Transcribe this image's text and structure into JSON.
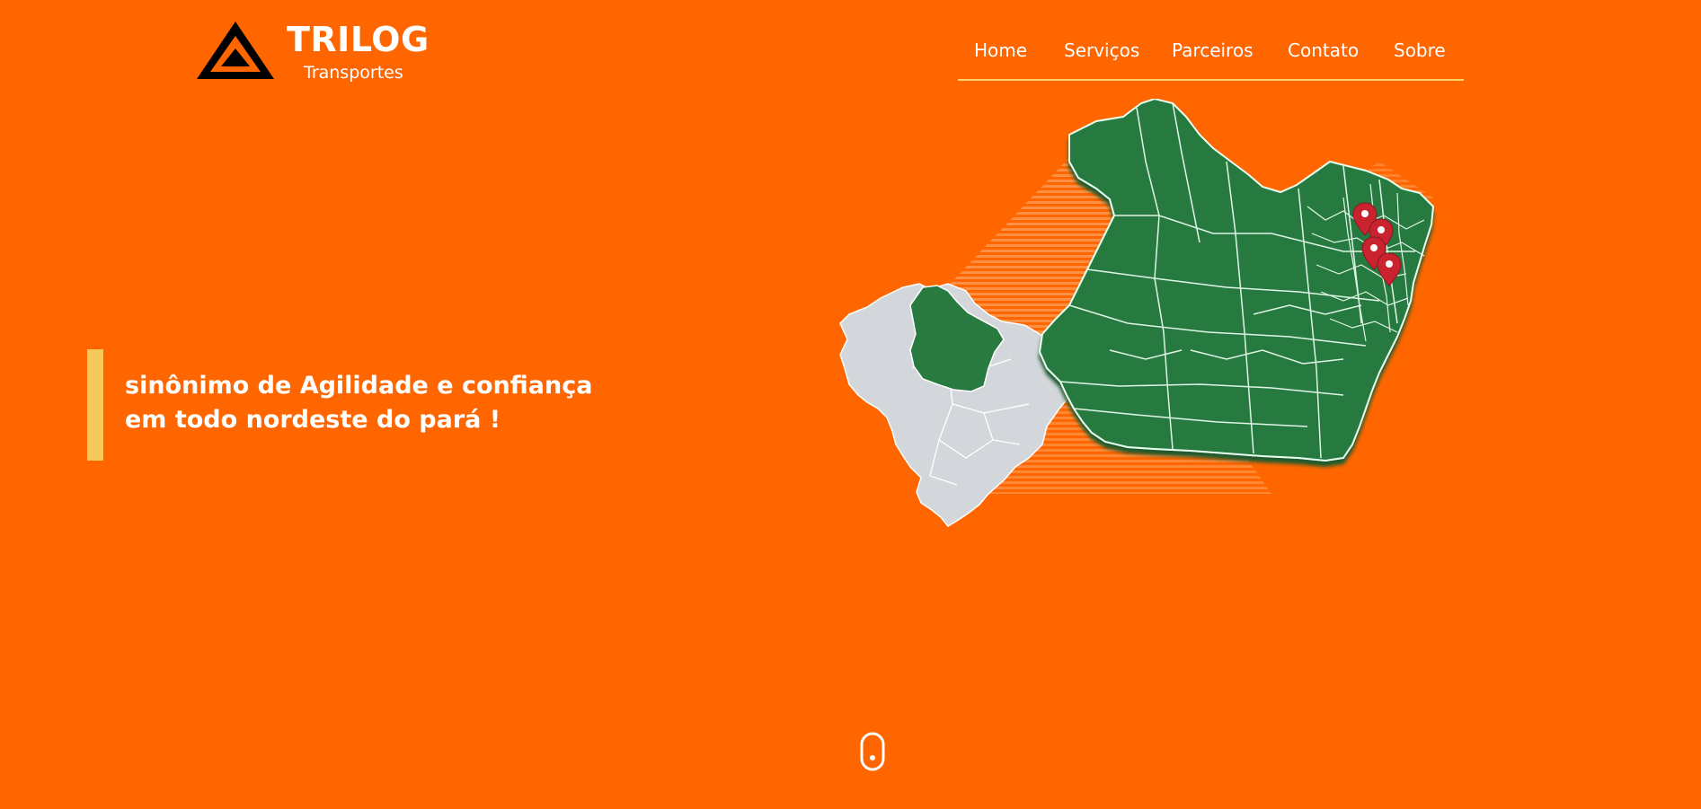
{
  "header": {
    "brand_name": "TRILOG",
    "brand_tagline": "Transportes"
  },
  "nav": {
    "items": [
      {
        "label": "Home"
      },
      {
        "label": "Serviços"
      },
      {
        "label": "Parceiros"
      },
      {
        "label": "Contato"
      },
      {
        "label": "Sobre"
      }
    ]
  },
  "hero": {
    "line1": "sinônimo de Agilidade e confiança",
    "line2": "em todo nordeste do pará !"
  },
  "illustration": {
    "brazil_map_icon": "brazil-map-icon",
    "para_state_map_icon": "para-state-map-icon",
    "location_pin_icon": "location-pin-icon",
    "location_pin_count": 4
  },
  "colors": {
    "background": "#FF6600",
    "accent_bar": "#F7C85A",
    "nav_underline": "#FFD36B",
    "map_green": "#287A40",
    "map_gray": "#D3D7DC",
    "pin_red": "#C8232F"
  },
  "icons": {
    "logo": "triangle-mountain-icon",
    "scroll": "mouse-scroll-icon"
  }
}
